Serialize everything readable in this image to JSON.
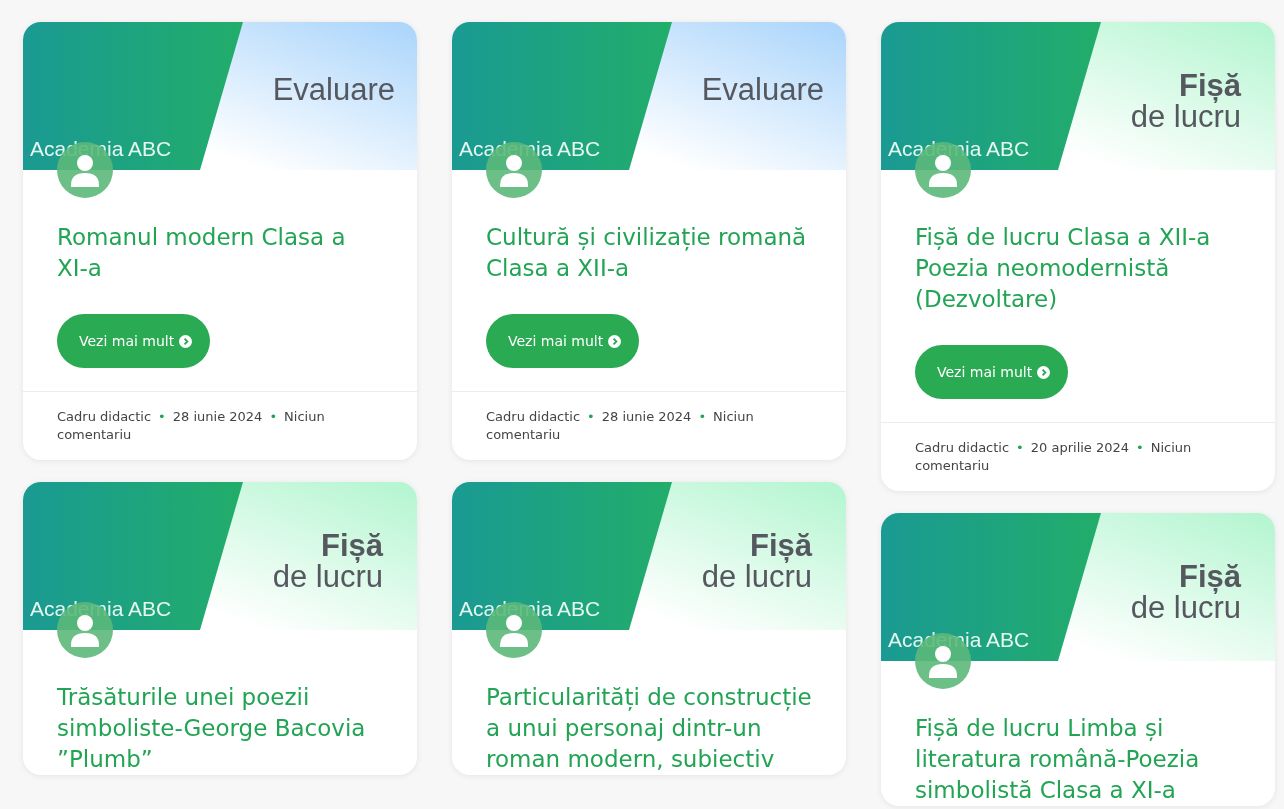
{
  "columns": [
    {
      "cards": [
        {
          "banner": {
            "kind": "evaluare",
            "lines": [
              "Evaluare"
            ],
            "brand": "Academia ABC"
          },
          "title": "Romanul modern Clasa a XI-a",
          "button": "Vezi mai mult",
          "meta": {
            "author": "Cadru didactic",
            "separator": "•",
            "date": "28 iunie 2024",
            "comments": "Niciun comentariu"
          }
        },
        {
          "banner": {
            "kind": "fisa",
            "lines": [
              "Fișă",
              "de lucru"
            ],
            "brand": "Academia ABC"
          },
          "title": "Trăsăturile unei poezii simboliste-George Bacovia ”Plumb”"
        }
      ]
    },
    {
      "cards": [
        {
          "banner": {
            "kind": "evaluare",
            "lines": [
              "Evaluare"
            ],
            "brand": "Academia ABC"
          },
          "title": "Cultură și civilizație romană Clasa a XII-a",
          "button": "Vezi mai mult",
          "meta": {
            "author": "Cadru didactic",
            "separator": "•",
            "date": "28 iunie 2024",
            "comments": "Niciun comentariu"
          }
        },
        {
          "banner": {
            "kind": "fisa",
            "lines": [
              "Fișă",
              "de lucru"
            ],
            "brand": "Academia ABC"
          },
          "title": "Particularități de construcție a unui personaj dintr-un roman modern, subiectiv"
        }
      ]
    },
    {
      "cards": [
        {
          "banner": {
            "kind": "fisa",
            "lines": [
              "Fișă",
              "de lucru"
            ],
            "brand": "Academia ABC"
          },
          "title": "Fișă de lucru Clasa a XII-a Poezia neomodernistă (Dezvoltare)",
          "button": "Vezi mai mult",
          "meta": {
            "author": "Cadru didactic",
            "separator": "•",
            "date": "20 aprilie 2024",
            "comments": "Niciun comentariu"
          }
        },
        {
          "banner": {
            "kind": "fisa",
            "lines": [
              "Fișă",
              "de lucru"
            ],
            "brand": "Academia ABC"
          },
          "title": "Fișă de lucru Limba și literatura română-Poezia simbolistă Clasa a XI-a"
        }
      ]
    }
  ]
}
